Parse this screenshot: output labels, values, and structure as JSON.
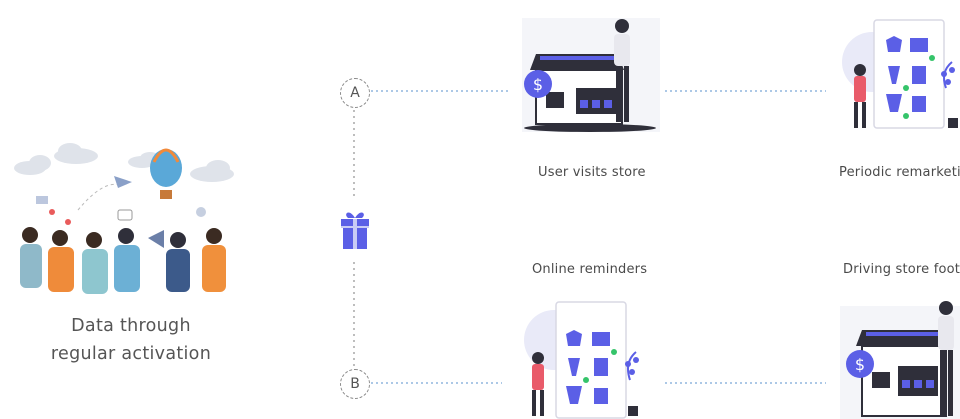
{
  "left": {
    "caption_line1": "Data through",
    "caption_line2": "regular activation"
  },
  "flows": {
    "a_label": "A",
    "b_label": "B"
  },
  "steps": {
    "user_visits_store": "User visits store",
    "periodic_remarketing": "Periodic remarketing",
    "online_reminders": "Online reminders",
    "driving_store_footfall": "Driving store footfal"
  },
  "colors": {
    "accent": "#5b5fe6",
    "accent_light": "#c9cbf5",
    "dot_line": "#7aa6d6",
    "dashed_line": "#9a9a9a",
    "green_dot": "#35c46a",
    "dark": "#2f2f3a"
  }
}
